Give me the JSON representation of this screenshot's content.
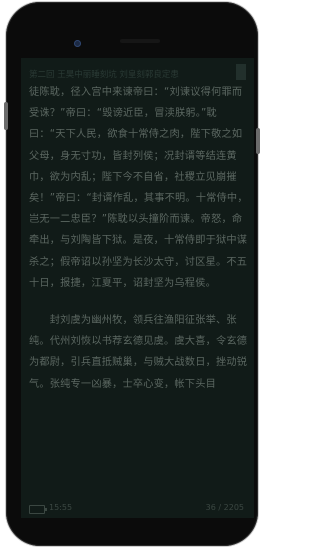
{
  "reader": {
    "chapter_title": "第二回 王昊中丽睡刻坑 刘皇刻郭良定患",
    "paragraph1": "徒陈耽，径入宫中来谏帝曰：“刘谏议得何罪而受诛？”帝曰：“毁谤近臣，冒渎朕躬。”耽曰：“天下人民，欲食十常侍之肉，陛下敬之如父母，身无寸功，皆封列侯；况封谞等结连黄巾，欲为内乱；陛下今不自省，社稷立见崩摧矣！”帝曰：“封谞作乱，其事不明。十常侍中，岂无一二忠臣？”陈耽以头撞阶而谏。帝怒，命牵出，与刘陶皆下狱。是夜，十常侍即于狱中谋杀之；假帝诏以孙坚为长沙太守，讨区星。不五十日，报捷，江夏平，诏封坚为乌程侯。",
    "paragraph2": "　　封刘虞为幽州牧，领兵往渔阳征张举、张纯。代州刘恢以书荐玄德见虞。虞大喜，令玄德为都尉，引兵直抵贼巢，与贼大战数日，挫动锐气。张纯专一凶暴，士卒心变，帐下头目"
  },
  "status": {
    "time": "15:55",
    "progress": "36 / 2205"
  },
  "colors": {
    "background": "#111b18",
    "text": "#5b6761"
  }
}
